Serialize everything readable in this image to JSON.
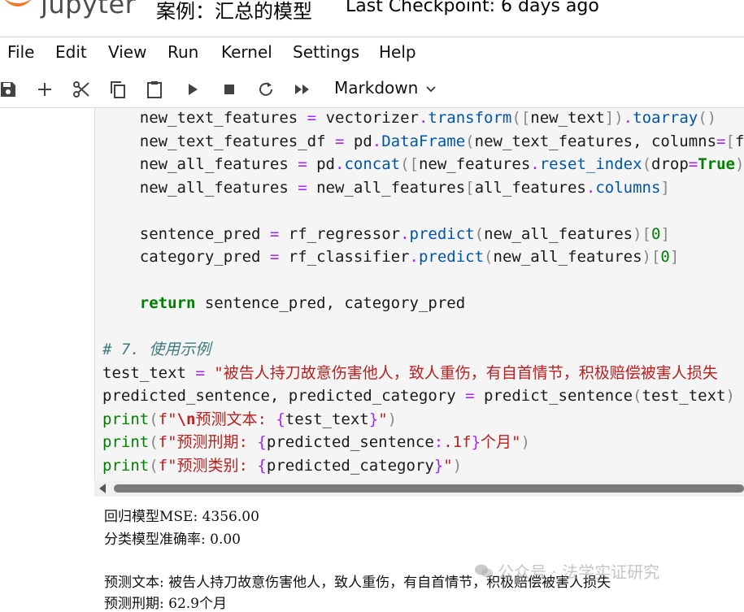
{
  "header": {
    "logo_text": "jupyter",
    "notebook_title": "案例：汇总的模型",
    "checkpoint": "Last Checkpoint: 6 days ago"
  },
  "menu": [
    "File",
    "Edit",
    "View",
    "Run",
    "Kernel",
    "Settings",
    "Help"
  ],
  "toolbar": {
    "icons": [
      "save-icon",
      "add-cell-icon",
      "cut-icon",
      "copy-icon",
      "paste-icon",
      "run-icon",
      "stop-icon",
      "restart-icon",
      "run-all-icon",
      "chevron-down-icon"
    ],
    "cell_type": "Markdown"
  },
  "code_lines": [
    "    new_text_features = vectorizer.transform([new_text]).toarray()",
    "    new_text_features_df = pd.DataFrame(new_text_features, columns=[f\"t",
    "    new_all_features = pd.concat([new_features.reset_index(drop=True),",
    "    new_all_features = new_all_features[all_features.columns]",
    "",
    "    sentence_pred = rf_regressor.predict(new_all_features)[0]",
    "    category_pred = rf_classifier.predict(new_all_features)[0]",
    "",
    "    return sentence_pred, category_pred",
    "",
    "# 7. 使用示例",
    "test_text = \"被告人持刀故意伤害他人，致人重伤，有自首情节，积极赔偿被害人损失",
    "predicted_sentence, predicted_category = predict_sentence(test_text)",
    "print(f\"\\n预测文本: {test_text}\")",
    "print(f\"预测刑期: {predicted_sentence:.1f}个月\")",
    "print(f\"预测类别: {predicted_category}\")"
  ],
  "output": {
    "line1": "回归模型MSE: 4356.00",
    "line2": "分类模型准确率: 0.00",
    "line3": "预测文本: 被告人持刀故意伤害他人，致人重伤，有自首情节，积极赔偿被害人损失",
    "line4": "预测刑期: 62.9个月"
  },
  "watermark": "公众号 · 法学实证研究",
  "colors": {
    "keyword": "#008000",
    "function": "#0055aa",
    "operator": "#aa22ff",
    "string": "#ba2121",
    "comment": "#3d7b7b",
    "logo_orange": "#f37726"
  }
}
